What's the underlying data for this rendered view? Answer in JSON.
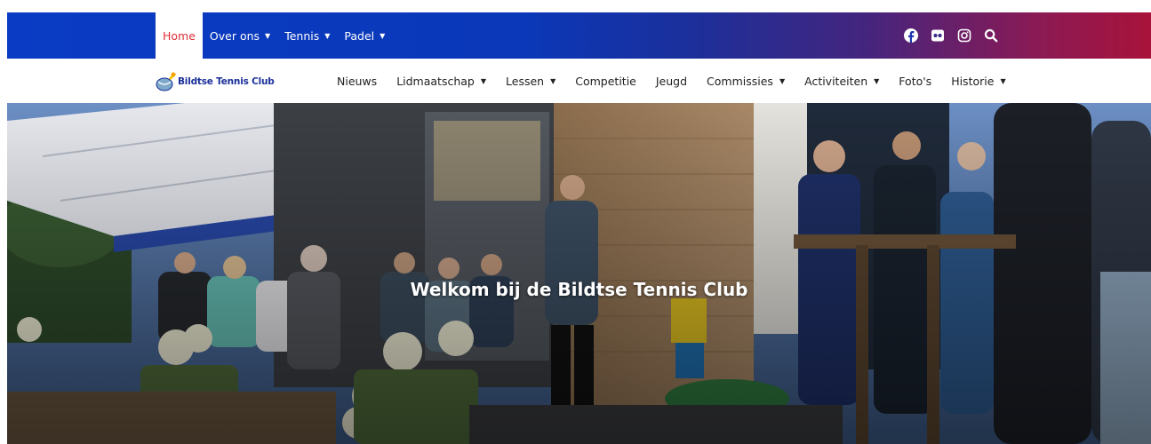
{
  "topbar": {
    "nav": [
      {
        "label": "Home",
        "active": true,
        "has_dropdown": false
      },
      {
        "label": "Over ons",
        "active": false,
        "has_dropdown": true
      },
      {
        "label": "Tennis",
        "active": false,
        "has_dropdown": true
      },
      {
        "label": "Padel",
        "active": false,
        "has_dropdown": true
      }
    ],
    "social_icons": [
      "facebook-icon",
      "flickr-icon",
      "instagram-icon",
      "search-icon"
    ],
    "colors": {
      "gradient_start": "#0a3bc4",
      "gradient_end": "#a8133a",
      "active_text": "#e0303a"
    }
  },
  "header": {
    "logo_text": "Bildtse Tennis Club",
    "nav": [
      {
        "label": "Nieuws",
        "has_dropdown": false
      },
      {
        "label": "Lidmaatschap",
        "has_dropdown": true
      },
      {
        "label": "Lessen",
        "has_dropdown": true
      },
      {
        "label": "Competitie",
        "has_dropdown": false
      },
      {
        "label": "Jeugd",
        "has_dropdown": false
      },
      {
        "label": "Commissies",
        "has_dropdown": true
      },
      {
        "label": "Activiteiten",
        "has_dropdown": true
      },
      {
        "label": "Foto's",
        "has_dropdown": false
      },
      {
        "label": "Historie",
        "has_dropdown": true
      }
    ]
  },
  "hero": {
    "title": "Welkom bij de Bildtse Tennis Club"
  }
}
